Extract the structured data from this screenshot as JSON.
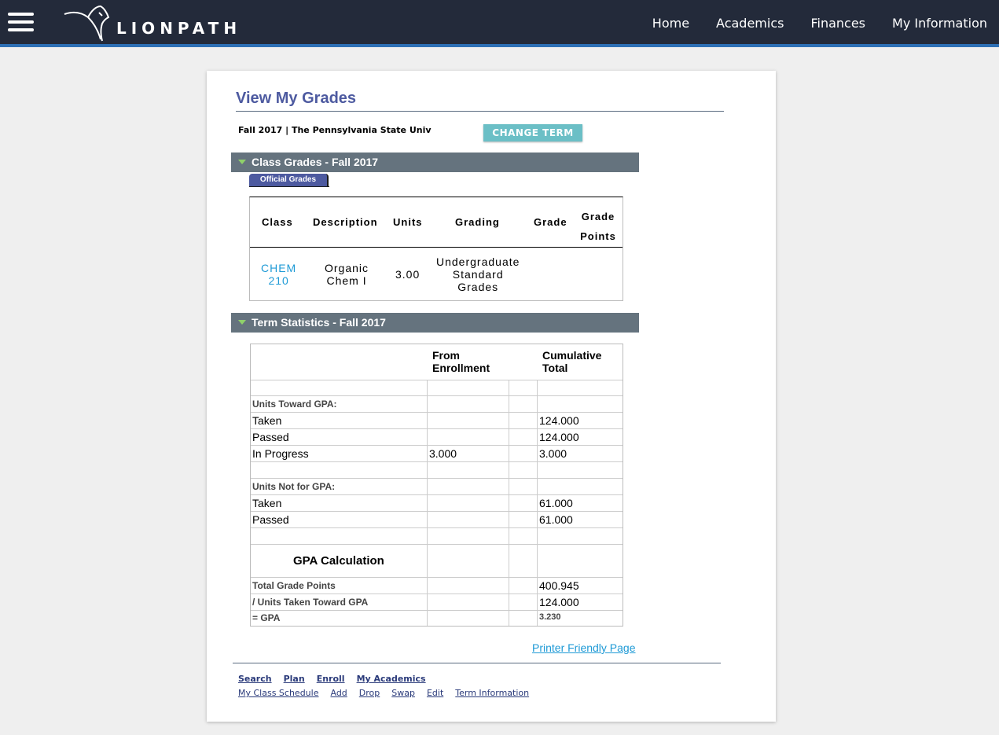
{
  "header": {
    "logo_text": "LIONPATH",
    "nav": [
      "Home",
      "Academics",
      "Finances",
      "My Information"
    ]
  },
  "page": {
    "title": "View My Grades",
    "term_line": "Fall 2017 | The Pennsylvania State Univ",
    "change_term": "CHANGE TERM",
    "printer_link": "Printer Friendly Page"
  },
  "class_grades": {
    "section_title": "Class Grades - Fall 2017",
    "tab_label": "Official Grades",
    "headers": [
      "Class",
      "Description",
      "Units",
      "Grading",
      "Grade",
      "Grade Points"
    ],
    "row": {
      "class_line1": "CHEM",
      "class_line2": "210",
      "description_line1": "Organic",
      "description_line2": "Chem I",
      "units": "3.00",
      "grading_line1": "Undergraduate",
      "grading_line2": "Standard",
      "grading_line3": "Grades",
      "grade": "",
      "grade_points": ""
    }
  },
  "term_stats": {
    "section_title": "Term Statistics - Fall 2017",
    "col_from_line1": "From",
    "col_from_line2": "Enrollment",
    "col_cum_line1": "Cumulative",
    "col_cum_line2": "Total",
    "units_toward_gpa": "Units Toward GPA:",
    "taken": "Taken",
    "taken_cum": "124.000",
    "passed": "Passed",
    "passed_cum": "124.000",
    "in_progress": "In Progress",
    "in_progress_from": "3.000",
    "in_progress_cum": "3.000",
    "units_not_gpa": "Units Not for GPA:",
    "ng_taken": "Taken",
    "ng_taken_cum": "61.000",
    "ng_passed": "Passed",
    "ng_passed_cum": "61.000",
    "gpa_calc": "GPA Calculation",
    "total_grade_points": "Total Grade Points",
    "total_grade_points_cum": "400.945",
    "units_taken_gpa": "/  Units Taken Toward GPA",
    "units_taken_gpa_cum": "124.000",
    "gpa": "= GPA",
    "gpa_cum": "3.230"
  },
  "footer": {
    "primary": [
      "Search",
      "Plan",
      "Enroll",
      "My Academics"
    ],
    "secondary": [
      "My Class Schedule",
      "Add",
      "Drop",
      "Swap",
      "Edit",
      "Term Information"
    ]
  }
}
